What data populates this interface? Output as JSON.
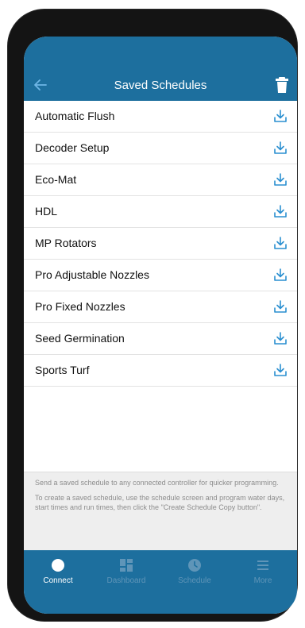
{
  "header": {
    "title": "Saved Schedules",
    "back_icon": "back-arrow-icon",
    "delete_icon": "trash-icon"
  },
  "schedules": [
    {
      "label": "Automatic Flush",
      "icon": "download-icon"
    },
    {
      "label": "Decoder Setup",
      "icon": "download-icon"
    },
    {
      "label": "Eco-Mat",
      "icon": "download-icon"
    },
    {
      "label": "HDL",
      "icon": "download-icon"
    },
    {
      "label": "MP Rotators",
      "icon": "download-icon"
    },
    {
      "label": "Pro Adjustable Nozzles",
      "icon": "download-icon"
    },
    {
      "label": "Pro Fixed Nozzles",
      "icon": "download-icon"
    },
    {
      "label": "Seed Germination",
      "icon": "download-icon"
    },
    {
      "label": "Sports Turf",
      "icon": "download-icon"
    }
  ],
  "info": {
    "line1": "Send a saved schedule to any connected controller for quicker programming.",
    "line2": "To create a saved schedule, use the schedule screen and program water days, start times and run times, then click the \"Create Schedule Copy button\"."
  },
  "tabs": [
    {
      "label": "Connect",
      "icon": "connect-circle-icon",
      "active": true
    },
    {
      "label": "Dashboard",
      "icon": "dashboard-grid-icon",
      "active": false
    },
    {
      "label": "Schedule",
      "icon": "clock-icon",
      "active": false
    },
    {
      "label": "More",
      "icon": "menu-icon",
      "active": false
    }
  ],
  "colors": {
    "brand": "#1d6f9e",
    "accent_icon": "#2a8fd0",
    "tab_inactive": "#5f95b8",
    "info_bg": "#eeeeee"
  }
}
